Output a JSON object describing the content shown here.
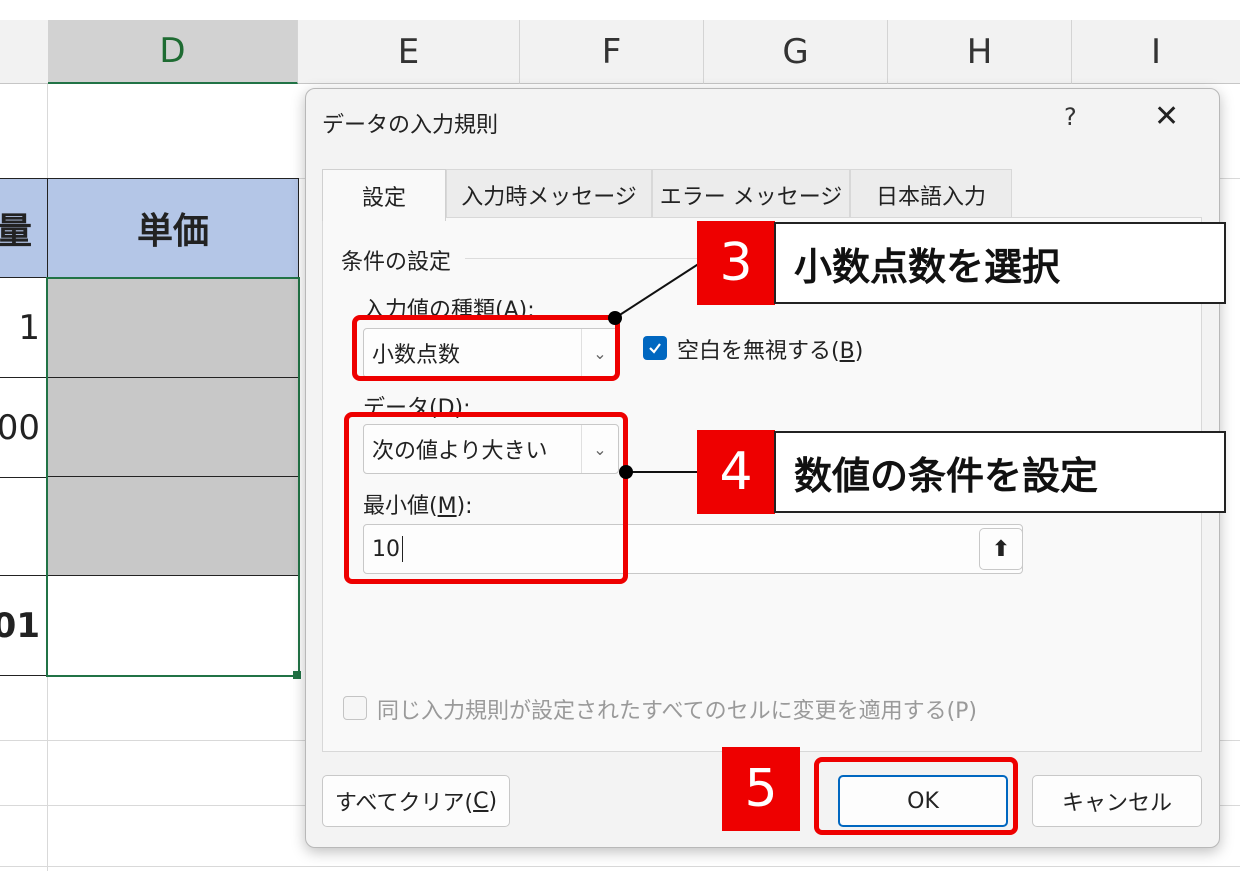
{
  "sheet": {
    "columns": [
      "D",
      "E",
      "F",
      "G",
      "H",
      "I"
    ],
    "header_partial": "量",
    "header_unit_price": "単価",
    "row_values": [
      "1",
      "00",
      "",
      "01"
    ]
  },
  "dialog": {
    "title": "データの入力規則",
    "help": "?",
    "close": "✕",
    "tabs": [
      "設定",
      "入力時メッセージ",
      "エラー メッセージ",
      "日本語入力"
    ],
    "group_title": "条件の設定",
    "allow_label": "入力値の種類(A):",
    "allow_value": "小数点数",
    "ignore_blank": {
      "prefix": "空白を無視する(",
      "key": "B",
      "suffix": ")",
      "checked": true
    },
    "data_label": "データ(D):",
    "data_value": "次の値より大きい",
    "min_label": {
      "prefix": "最小値(",
      "key": "M",
      "suffix": "):"
    },
    "min_value": "10",
    "apply_all": "同じ入力規則が設定されたすべてのセルに変更を適用する(P)",
    "clear_all": {
      "prefix": "すべてクリア(",
      "key": "C",
      "suffix": ")"
    },
    "ok": "OK",
    "cancel": "キャンセル"
  },
  "annotations": {
    "step3_num": "3",
    "step3_text": "小数点数を選択",
    "step4_num": "4",
    "step4_text": "数値の条件を設定",
    "step5_num": "5"
  },
  "colors": {
    "annotation_red": "#ee0000",
    "header_blue": "#b4c6e7",
    "selected_col_green": "#217346",
    "checkbox_blue": "#0067c0"
  }
}
